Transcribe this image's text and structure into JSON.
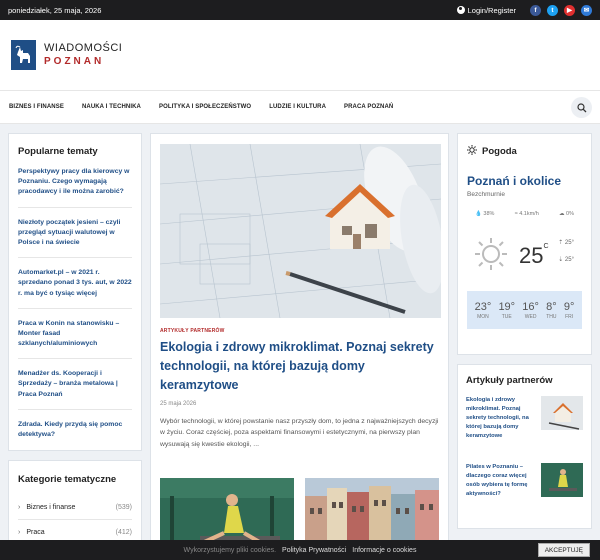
{
  "topbar": {
    "date": "poniedziałek, 25 maja, 2026",
    "login": "Login/Register",
    "social": [
      {
        "icon": "facebook-icon",
        "glyph": "f",
        "color": "#3b5998"
      },
      {
        "icon": "twitter-icon",
        "glyph": "t",
        "color": "#1da1f2"
      },
      {
        "icon": "youtube-icon",
        "glyph": "▶",
        "color": "#e02f2f"
      },
      {
        "icon": "mail-icon",
        "glyph": "✉",
        "color": "#2f7ad8"
      }
    ]
  },
  "logo": {
    "line1": "WIADOMOŚCI",
    "line2": "POZNAN",
    "icon": "goat-icon"
  },
  "nav": {
    "items": [
      "BIZNES I FINANSE",
      "NAUKA I TECHNIKA",
      "POLITYKA I SPOŁECZEŃSTWO",
      "LUDZIE I KULTURA",
      "PRACA POZNAŃ"
    ],
    "search_icon": "search-icon"
  },
  "popular": {
    "title": "Popularne tematy",
    "items": [
      "Perspektywy pracy dla kierowcy w Poznaniu. Czego wymagają pracodawcy i ile można zarobić?",
      "Niezłoty początek jesieni – czyli przegląd sytuacji walutowej w Polsce i na świecie",
      "Automarket.pl – w 2021 r. sprzedano ponad 3 tys. aut, w 2022 r. ma być o tysiąc więcej",
      "Praca w Konin na stanowisku – Monter fasad szklanych/aluminiowych",
      "Menadżer ds. Kooperacji i Sprzedaży – branża metalowa | Praca Poznań",
      "Zdrada. Kiedy przydą się pomoc detektywa?"
    ]
  },
  "categories": {
    "title": "Kategorie tematyczne",
    "items": [
      {
        "name": "Biznes i finanse",
        "count": "(539)"
      },
      {
        "name": "Praca",
        "count": "(412)"
      }
    ]
  },
  "article": {
    "tag": "ARTYKUŁY PARTNERÓW",
    "title": "Ekologia i zdrowy mikroklimat. Poznaj sekrety technologii, na której bazują domy keramzytowe",
    "date": "25 maja 2026",
    "excerpt": "Wybór technologii, w której powstanie nasz przyszły dom, to jedna z najważniejszych decyzji w życiu. Coraz częściej, poza aspektami finansowymi i estetycznymi, na pierwszy plan wysuwają się kwestie ekologii, ..."
  },
  "weather": {
    "title": "Pogoda",
    "city": "Poznań i okolice",
    "subtitle": "Bezchmurnie",
    "humidity": "38%",
    "wind": "4.1km/h",
    "clouds": "0%",
    "temp": "25",
    "unit": "C",
    "high": "25°",
    "low": "25°",
    "forecast": [
      {
        "temp": "23°",
        "day": "MON"
      },
      {
        "temp": "19°",
        "day": "TUE"
      },
      {
        "temp": "16°",
        "day": "WED"
      },
      {
        "temp": "8°",
        "day": "THU"
      },
      {
        "temp": "9°",
        "day": "FRI"
      }
    ]
  },
  "partners": {
    "title": "Artykuły partnerów",
    "items": [
      "Ekologia i zdrowy mikroklimat. Poznaj sekrety technologii, na której bazują domy keramzytowe",
      "Pilates w Poznaniu – dlaczego coraz więcej osób wybiera tę formę aktywności?"
    ]
  },
  "cookie": {
    "text": "Wykorzystujemy pliki cookies.",
    "link1": "Polityka Prywatności",
    "link2": "Informacje o cookies",
    "button": "AKCEPTUJĘ"
  }
}
